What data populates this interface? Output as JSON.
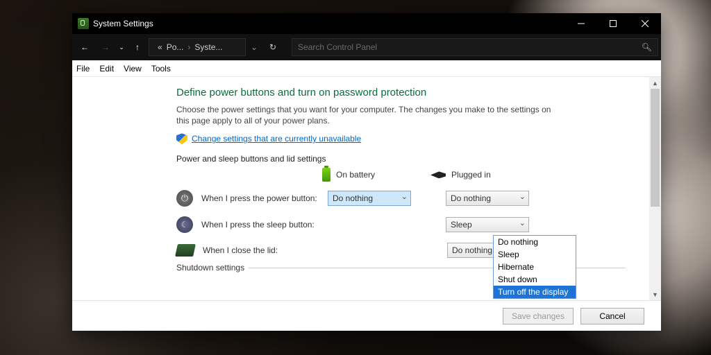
{
  "window": {
    "title": "System Settings"
  },
  "breadcrumb": {
    "seg0": "«",
    "seg1": "Po...",
    "seg2": "Syste..."
  },
  "search": {
    "placeholder": "Search Control Panel"
  },
  "menus": {
    "file": "File",
    "edit": "Edit",
    "view": "View",
    "tools": "Tools"
  },
  "page": {
    "heading": "Define power buttons and turn on password protection",
    "desc": "Choose the power settings that you want for your computer. The changes you make to the settings on this page apply to all of your power plans.",
    "change_link": "Change settings that are currently unavailable",
    "section1": "Power and sleep buttons and lid settings",
    "col_battery": "On battery",
    "col_plugged": "Plugged in",
    "rows": {
      "power": {
        "label": "When I press the power button:",
        "battery": "Do nothing",
        "plugged": "Do nothing"
      },
      "sleep": {
        "label": "When I press the sleep button:",
        "battery": "",
        "plugged": "Sleep"
      },
      "lid": {
        "label": "When I close the lid:",
        "battery": "",
        "plugged": "Do nothing"
      }
    },
    "dropdown_options": {
      "o0": "Do nothing",
      "o1": "Sleep",
      "o2": "Hibernate",
      "o3": "Shut down",
      "o4": "Turn off the display"
    },
    "section2": "Shutdown settings"
  },
  "footer": {
    "save": "Save changes",
    "cancel": "Cancel"
  }
}
